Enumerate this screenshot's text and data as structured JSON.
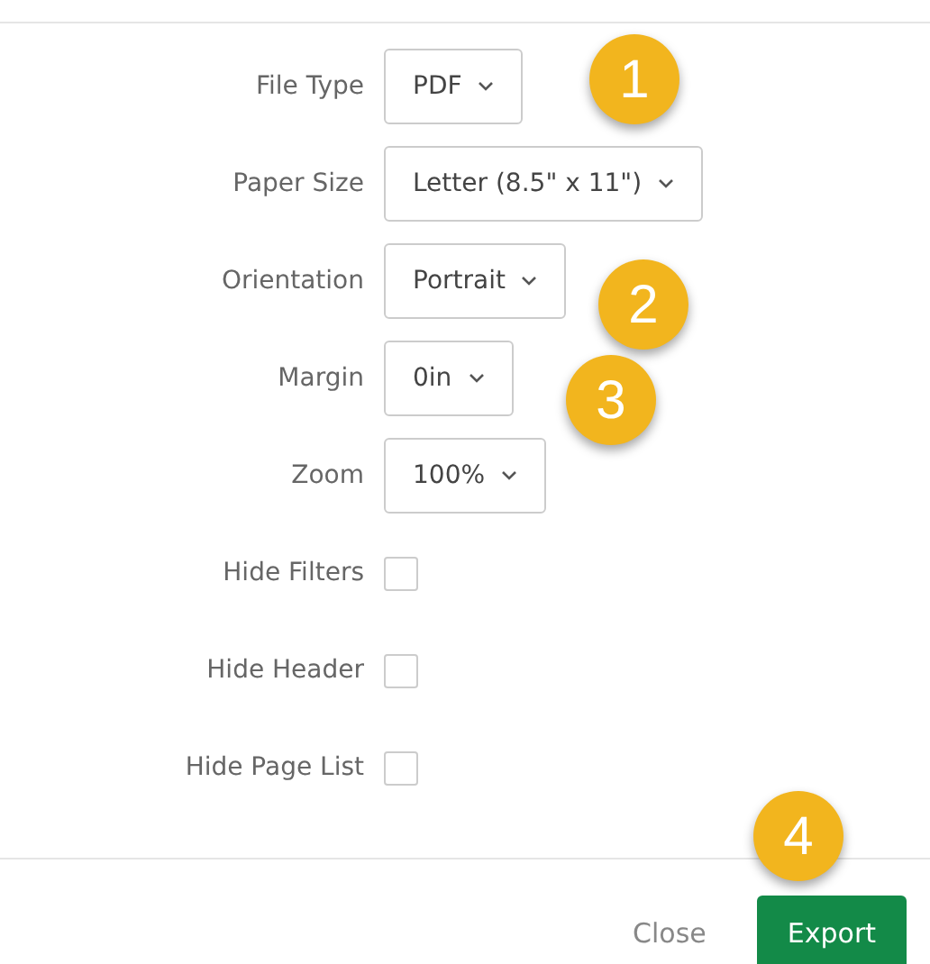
{
  "fields": [
    {
      "kind": "select",
      "label": "File Type",
      "value": "PDF"
    },
    {
      "kind": "select",
      "label": "Paper Size",
      "value": "Letter (8.5\" x 11\")"
    },
    {
      "kind": "select",
      "label": "Orientation",
      "value": "Portrait"
    },
    {
      "kind": "select",
      "label": "Margin",
      "value": "0in"
    },
    {
      "kind": "select",
      "label": "Zoom",
      "value": "100%"
    },
    {
      "kind": "checkbox",
      "label": "Hide Filters",
      "checked": false
    },
    {
      "kind": "checkbox",
      "label": "Hide Header",
      "checked": false
    },
    {
      "kind": "checkbox",
      "label": "Hide Page List",
      "checked": false
    }
  ],
  "callouts": [
    "1",
    "2",
    "3",
    "4"
  ],
  "buttons": [
    {
      "kind": "link",
      "label": "Close"
    },
    {
      "kind": "primary",
      "label": "Export"
    }
  ]
}
